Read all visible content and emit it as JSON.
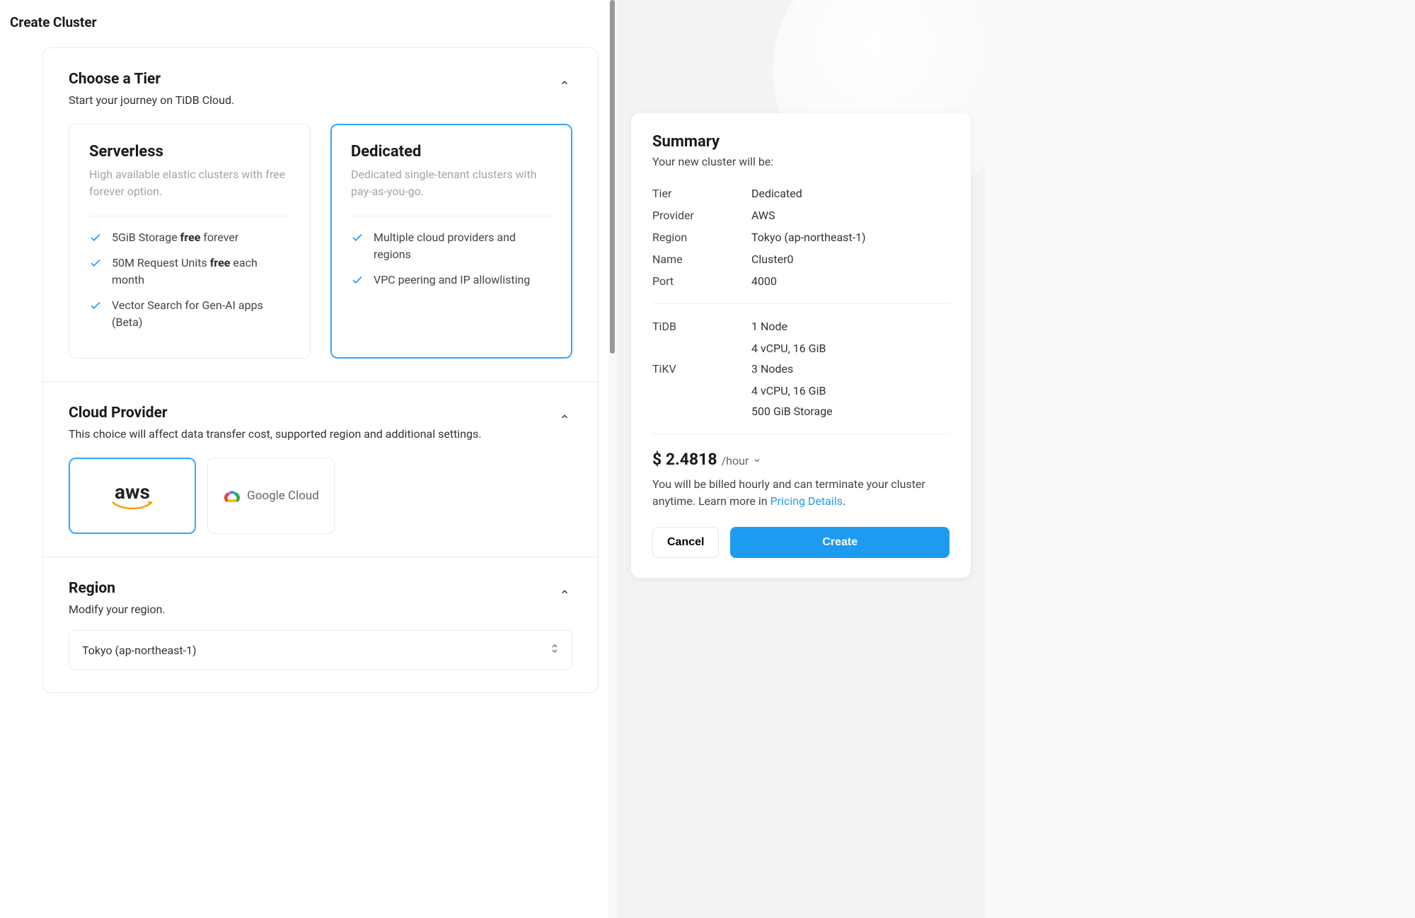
{
  "page": {
    "title": "Create Cluster"
  },
  "tier_section": {
    "heading": "Choose a Tier",
    "sub": "Start your journey on TiDB Cloud."
  },
  "tiers": {
    "serverless": {
      "name": "Serverless",
      "desc": "High available elastic clusters with free forever option.",
      "f1_pre": "5GiB Storage ",
      "f1_bold": "free",
      "f1_post": " forever",
      "f2_pre": "50M Request Units ",
      "f2_bold": "free",
      "f2_post": " each month",
      "f3": "Vector Search for Gen-AI apps (Beta)"
    },
    "dedicated": {
      "name": "Dedicated",
      "desc": "Dedicated single-tenant clusters with pay-as-you-go.",
      "f1": "Multiple cloud providers and regions",
      "f2": "VPC peering and IP allowlisting"
    }
  },
  "provider_section": {
    "heading": "Cloud Provider",
    "sub": "This choice will affect data transfer cost, supported region and additional settings."
  },
  "providers": {
    "aws": "aws",
    "gcloud": "Google Cloud"
  },
  "region_section": {
    "heading": "Region",
    "sub": "Modify your region.",
    "selected": "Tokyo (ap-northeast-1)"
  },
  "summary": {
    "title": "Summary",
    "sub": "Your new cluster will be:",
    "rows": {
      "tier_label": "Tier",
      "tier_value": "Dedicated",
      "provider_label": "Provider",
      "provider_value": "AWS",
      "region_label": "Region",
      "region_value": "Tokyo (ap-northeast-1)",
      "name_label": "Name",
      "name_value": "Cluster0",
      "port_label": "Port",
      "port_value": "4000"
    },
    "tidb_label": "TiDB",
    "tidb_nodes": "1 Node",
    "tidb_spec": "4 vCPU, 16 GiB",
    "tikv_label": "TiKV",
    "tikv_nodes": "3 Nodes",
    "tikv_spec": "4 vCPU, 16 GiB",
    "tikv_storage": "500 GiB Storage",
    "price": "$ 2.4818",
    "price_unit": "/hour",
    "billing_text": "You will be billed hourly and can terminate your cluster anytime. Learn more in ",
    "pricing_link": "Pricing Details",
    "billing_suffix": ".",
    "cancel": "Cancel",
    "create": "Create"
  }
}
